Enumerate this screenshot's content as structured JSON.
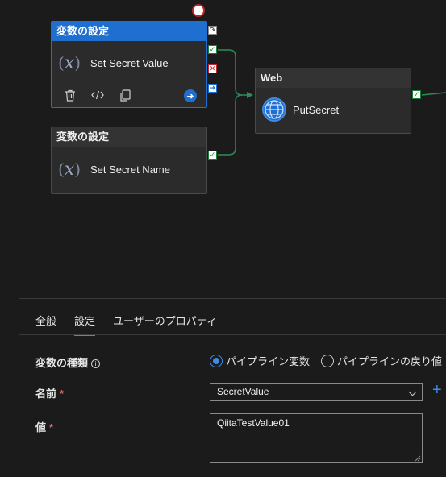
{
  "pipeline": {
    "activities": [
      {
        "type_label": "変数の設定",
        "name": "Set Secret Value",
        "selected": true
      },
      {
        "type_label": "変数の設定",
        "name": "Set Secret Name",
        "selected": false
      },
      {
        "type_label": "Web",
        "name": "PutSecret",
        "selected": false
      }
    ],
    "var_icon_text": "x"
  },
  "panel": {
    "tabs": [
      {
        "label": "全般",
        "active": false
      },
      {
        "label": "設定",
        "active": true
      },
      {
        "label": "ユーザーのプロパティ",
        "active": false
      }
    ],
    "variable_type": {
      "label": "変数の種類",
      "options": [
        {
          "label": "パイプライン変数",
          "selected": true
        },
        {
          "label": "パイプラインの戻り値",
          "selected": false
        }
      ]
    },
    "name": {
      "label": "名前",
      "required_mark": "*",
      "value": "SecretValue"
    },
    "value": {
      "label": "値",
      "required_mark": "*",
      "value": "QiitaTestValue01"
    }
  },
  "colors": {
    "accent": "#1f6fd1",
    "success": "#1a7f37",
    "fail": "#c4262e",
    "background": "#1b1b1b"
  }
}
